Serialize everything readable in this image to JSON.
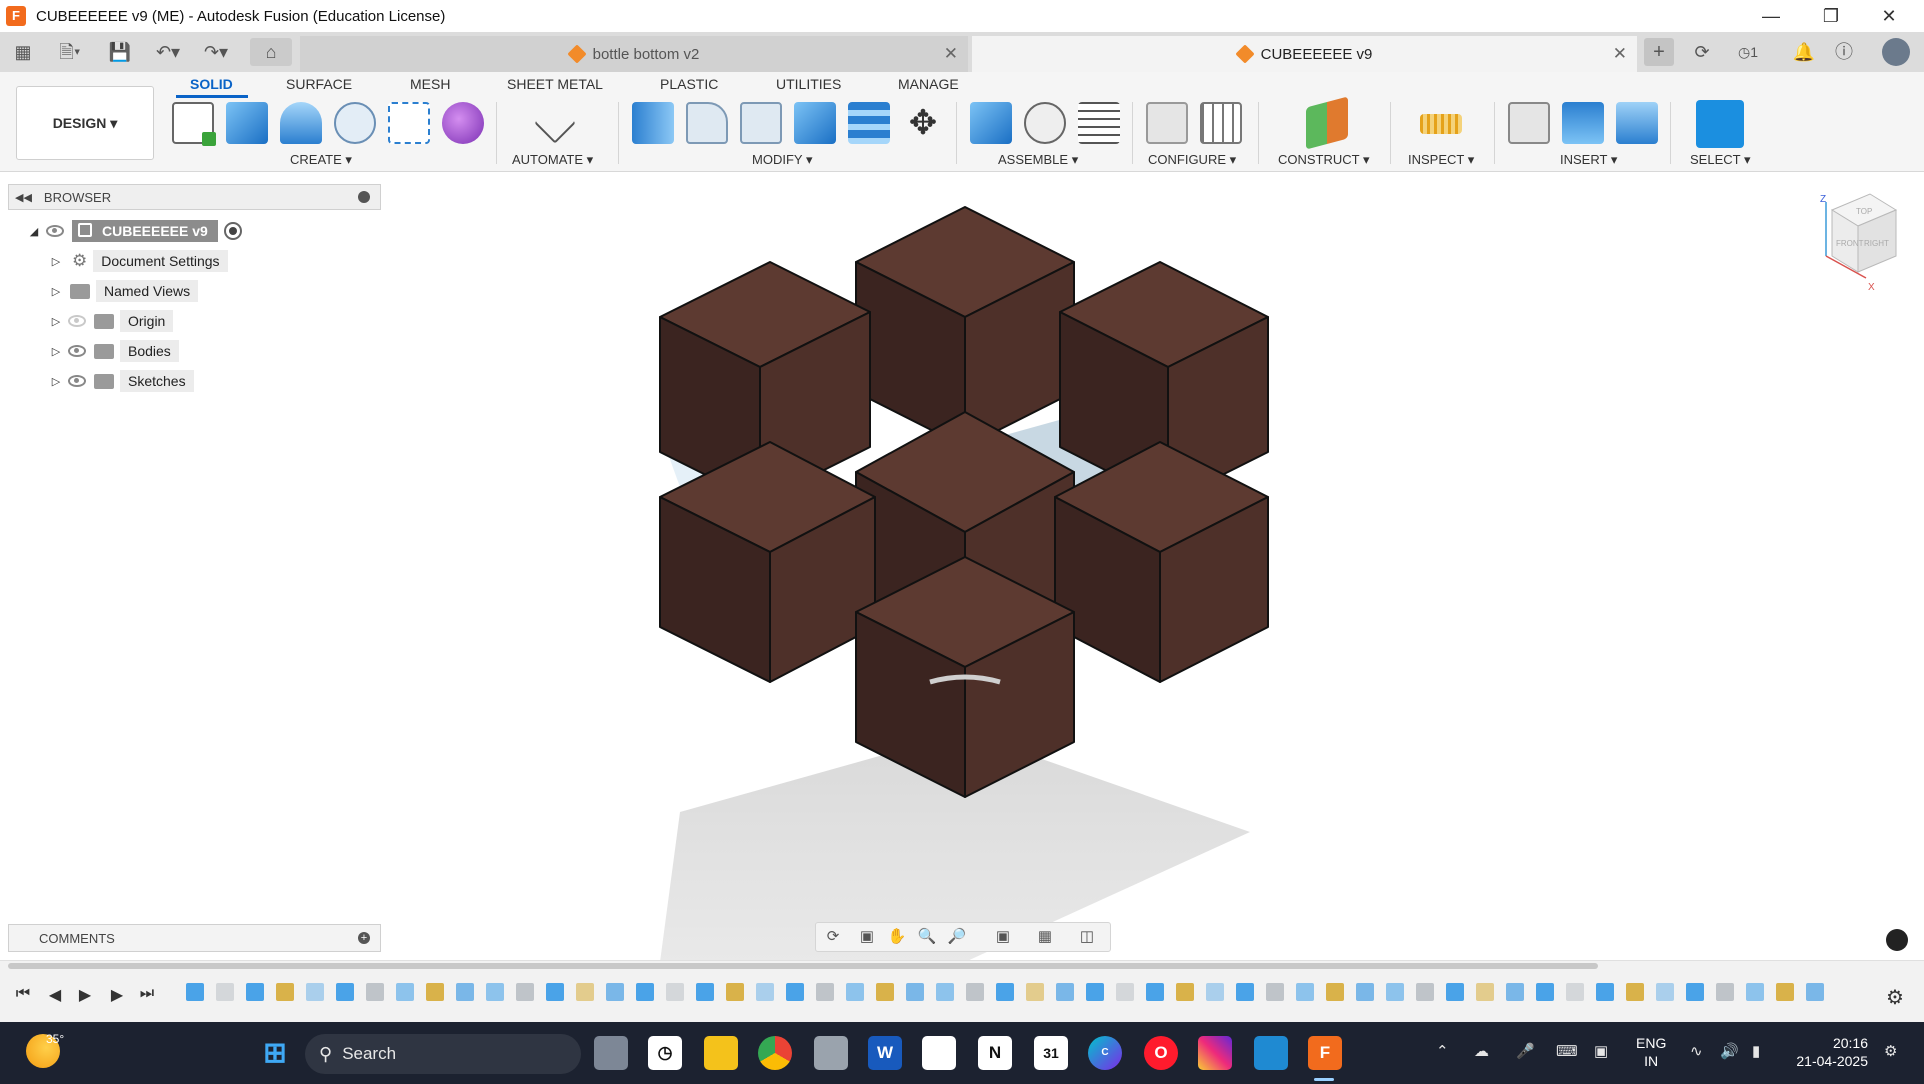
{
  "window": {
    "title": "CUBEEEEEE v9 (ME) - Autodesk Fusion (Education License)",
    "app_icon_letter": "F",
    "controls": [
      "minimize",
      "restore",
      "close"
    ]
  },
  "tabs": [
    {
      "label": "bottle bottom v2",
      "active": false
    },
    {
      "label": "CUBEEEEEE v9",
      "active": true
    }
  ],
  "header_right": {
    "jobs_count": "1"
  },
  "toolbar": {
    "workspace": "DESIGN",
    "workspace_tabs": [
      "SOLID",
      "SURFACE",
      "MESH",
      "SHEET METAL",
      "PLASTIC",
      "UTILITIES",
      "MANAGE"
    ],
    "groups": [
      "CREATE",
      "AUTOMATE",
      "MODIFY",
      "ASSEMBLE",
      "CONFIGURE",
      "CONSTRUCT",
      "INSPECT",
      "INSERT",
      "SELECT"
    ]
  },
  "browser": {
    "title": "BROWSER",
    "root": "CUBEEEEEE v9",
    "items": [
      {
        "label": "Document Settings",
        "icon": "gear-icon"
      },
      {
        "label": "Named Views",
        "icon": "folder-icon"
      },
      {
        "label": "Origin",
        "icon": "folder-icon",
        "visible": false
      },
      {
        "label": "Bodies",
        "icon": "folder-icon",
        "visible": true
      },
      {
        "label": "Sketches",
        "icon": "folder-icon",
        "visible": true
      }
    ]
  },
  "viewcube": {
    "faces": [
      "TOP",
      "FRONT",
      "RIGHT"
    ],
    "axes": [
      "Z",
      "X"
    ]
  },
  "comments": {
    "title": "COMMENTS"
  },
  "taskbar": {
    "weather": "35°",
    "search_placeholder": "Search",
    "language": "ENG",
    "region": "IN",
    "time": "20:16",
    "date": "21-04-2025"
  },
  "colors": {
    "accent": "#0a63c7",
    "wood_dark": "#3b2420",
    "wood_mid": "#4e3029",
    "wood_light": "#5d3a31",
    "taskbar": "#1c2230"
  }
}
